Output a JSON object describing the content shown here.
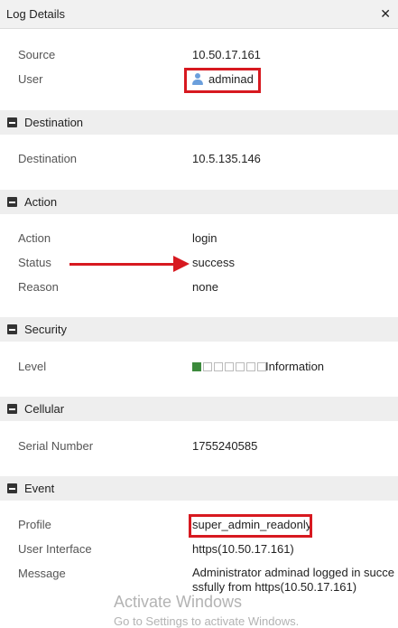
{
  "window": {
    "title": "Log Details",
    "close_glyph": "✕"
  },
  "rows": {
    "source": {
      "label": "Source",
      "value": "10.50.17.161"
    },
    "user": {
      "label": "User",
      "value": "adminad",
      "icon": "user-icon"
    },
    "destination": {
      "label": "Destination",
      "value": "10.5.135.146"
    },
    "action": {
      "label": "Action",
      "value": "login"
    },
    "status": {
      "label": "Status",
      "value": "success"
    },
    "reason": {
      "label": "Reason",
      "value": "none"
    },
    "level": {
      "label": "Level",
      "value": "Information",
      "filled_segments": 1,
      "total_segments": 7,
      "fill_color": "#3c8a3c"
    },
    "serial": {
      "label": "Serial Number",
      "value": "1755240585"
    },
    "profile": {
      "label": "Profile",
      "value": "super_admin_readonly"
    },
    "ui": {
      "label": "User Interface",
      "value": "https(10.50.17.161)"
    },
    "message": {
      "label": "Message",
      "value": "Administrator adminad logged in successfully from https(10.50.17.161)",
      "line1": "Administrator adminad logged in succe",
      "line2": "ssfully from https(10.50.17.161)"
    }
  },
  "sections": {
    "destination": "Destination",
    "action": "Action",
    "security": "Security",
    "cellular": "Cellular",
    "event": "Event"
  },
  "annotations": {
    "highlight_color": "#d71920"
  },
  "watermark": {
    "line1": "Activate Windows",
    "line2": "Go to Settings to activate Windows."
  }
}
